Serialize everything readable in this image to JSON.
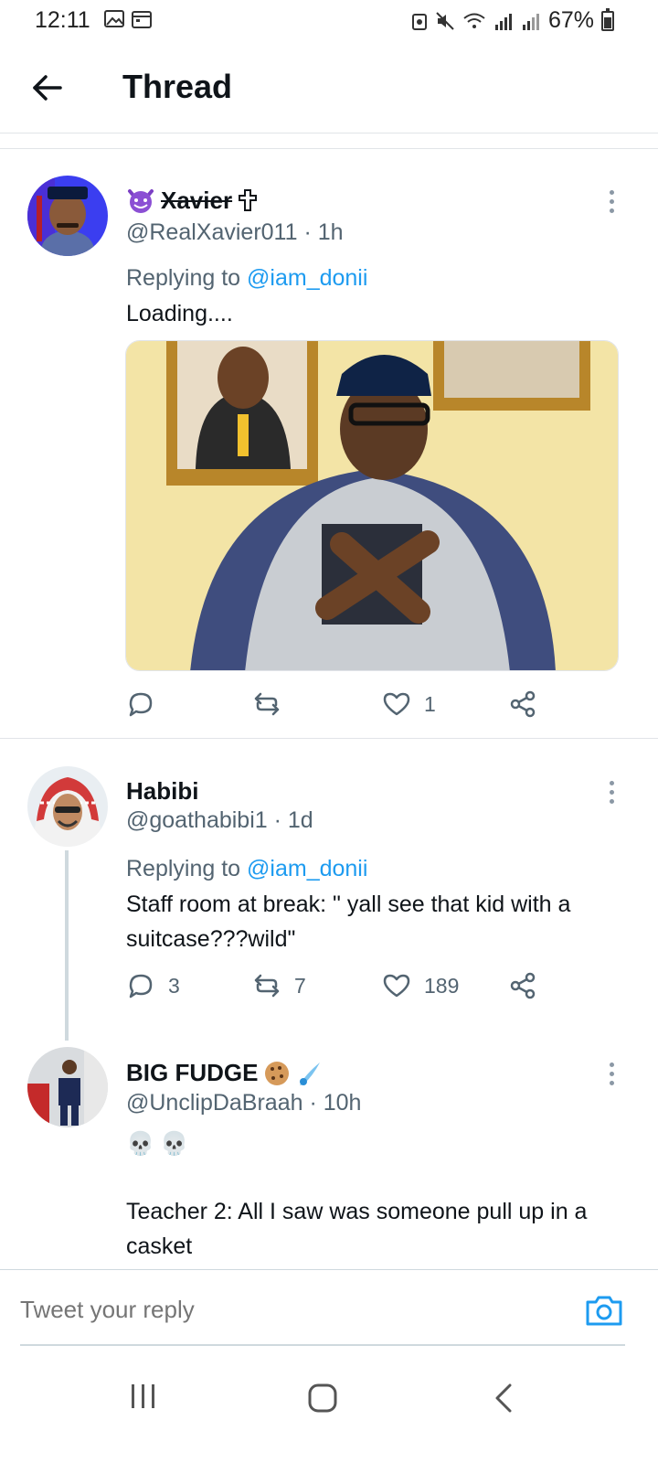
{
  "status_bar": {
    "time": "12:11",
    "battery": "67%"
  },
  "header": {
    "title": "Thread"
  },
  "tweets": [
    {
      "name": "Xavier",
      "handle_time": "@RealXavier011 · 1h",
      "replying_label": "Replying to ",
      "replying_mention": "@iam_donii",
      "text": "Loading....",
      "media_alt": "Photo of man in cap crossing index fingers",
      "replies": "",
      "retweets": "",
      "likes": "1"
    },
    {
      "name": "Habibi",
      "handle_time": "@goathabibi1 · 1d",
      "replying_label": "Replying to ",
      "replying_mention": "@iam_donii",
      "text": "Staff room at break: \" yall see that kid with a suitcase???wild\"",
      "replies": "3",
      "retweets": "7",
      "likes": "189"
    },
    {
      "name": "BIG FUDGE",
      "handle_time": "@UnclipDaBraah · 10h",
      "emoji_line": "💀💀",
      "text": "Teacher 2: All I saw was someone pull up in a casket"
    }
  ],
  "reply_bar": {
    "placeholder": "Tweet your reply"
  },
  "colors": {
    "accent": "#1d9bf0",
    "text": "#0f1419",
    "muted": "#536471"
  }
}
